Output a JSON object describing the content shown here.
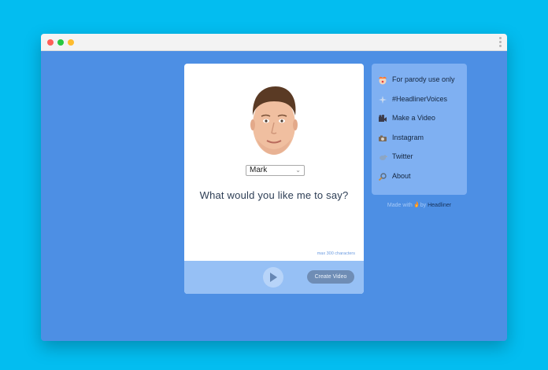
{
  "card": {
    "selected_voice": "Mark",
    "prompt": "What would you like me to say?",
    "max_chars": "max 300 characters",
    "create_label": "Create Video"
  },
  "sidebar": {
    "items": [
      {
        "label": "For parody use only",
        "icon": "clown-icon"
      },
      {
        "label": "#HeadlinerVoices",
        "icon": "sparkle-icon"
      },
      {
        "label": "Make a Video",
        "icon": "video-camera-icon"
      },
      {
        "label": "Instagram",
        "icon": "camera-icon"
      },
      {
        "label": "Twitter",
        "icon": "bird-icon"
      },
      {
        "label": "About",
        "icon": "magnifier-icon"
      }
    ]
  },
  "footer": {
    "made_with": "Made with",
    "by": "by",
    "brand": "Headliner"
  },
  "colors": {
    "page_bg": "#03bdf0",
    "window_bg": "#4d8fe4",
    "sidebar_bg": "#7fb0f2",
    "footer_bg": "#96c0f5",
    "button_bg": "#6f8db5"
  }
}
